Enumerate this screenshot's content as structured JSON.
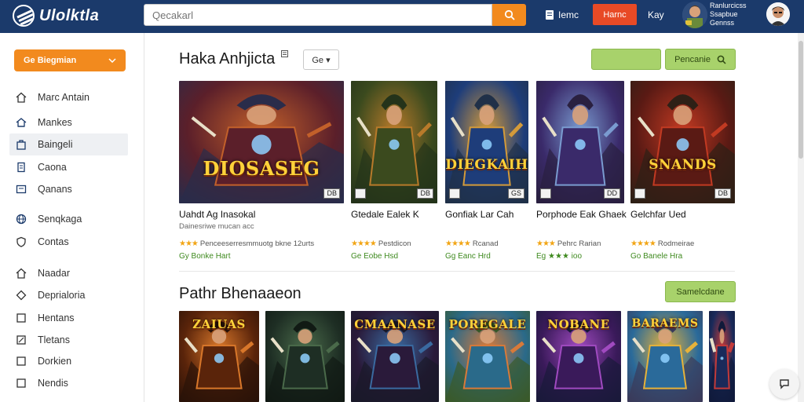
{
  "header": {
    "logo_text": "Ulolktla",
    "search_placeholder": "Qecakarl",
    "link1": "Iemc",
    "button": "Harnc",
    "link2": "Kay",
    "user_line1": "Ranlurcicss",
    "user_line2": "Ssapbue",
    "user_line3": "Gennss"
  },
  "sidebar": {
    "category_button": "Ge Biegmian",
    "items": [
      {
        "label": "Marc Antain",
        "icon": "home-icon"
      },
      {
        "label": "Mankes",
        "icon": "house-icon"
      },
      {
        "label": "Baingeli",
        "icon": "bag-icon"
      },
      {
        "label": "Caona",
        "icon": "document-icon"
      },
      {
        "label": "Qanans",
        "icon": "tablet-icon"
      },
      {
        "label": "Senqkaga",
        "icon": "globe-icon"
      },
      {
        "label": "Contas",
        "icon": "shield-icon"
      },
      {
        "label": "Naadar",
        "icon": "home-outline-icon"
      },
      {
        "label": "Deprialoria",
        "icon": "diamond-icon"
      },
      {
        "label": "Hentans",
        "icon": "square-icon"
      },
      {
        "label": "Tletans",
        "icon": "edit-icon"
      },
      {
        "label": "Dorkien",
        "icon": "square-icon"
      },
      {
        "label": "Nendis",
        "icon": "square-icon"
      }
    ]
  },
  "section1": {
    "title": "Haka Anhjicta",
    "sort_label": "Ge ▾",
    "button_plain": "",
    "button_search": "Pencanie",
    "games": [
      {
        "thumb_text": "DIOSASEG",
        "tag": "DB",
        "title": "Uahdt Ag Inasokal",
        "sub": "Dainesriwe mucan acc",
        "stars": "★★★",
        "rating": "Penceeserresmmuotg bkne 12urts",
        "price": "Gy Bonke Hart",
        "colors": [
          "#5b1f2a",
          "#c2602a",
          "#2a2c4a"
        ]
      },
      {
        "thumb_text": "",
        "tag": "DB",
        "title": "Gtedale Ealek K",
        "sub": "",
        "stars": "★★★★",
        "rating": "Pestdicon",
        "price": "Ge Eobe Hsd",
        "colors": [
          "#3b4a1e",
          "#b87a2a",
          "#24331a"
        ]
      },
      {
        "thumb_text": "DIEGKAIH",
        "tag": "GS",
        "title": "Gonfiak Lar Cah",
        "sub": "",
        "stars": "★★★★",
        "rating": "Rcanad",
        "price": "Gg Eanc Hrd",
        "colors": [
          "#1e3d7a",
          "#d39a3a",
          "#203048"
        ]
      },
      {
        "thumb_text": "",
        "tag": "DD",
        "title": "Porphode Eak Ghaek",
        "sub": "",
        "stars": "★★★",
        "rating": "Pehrc Rarian",
        "price": "Eg ★★★ ioo",
        "colors": [
          "#3a2a6a",
          "#7a9bd0",
          "#2a2040"
        ]
      },
      {
        "thumb_text": "SNANDS",
        "tag": "DB",
        "title": "Gelchfar Ued",
        "sub": "",
        "stars": "★★★★",
        "rating": "Rodmeirae",
        "price": "Go Banele Hra",
        "colors": [
          "#5a1a14",
          "#c23a22",
          "#2e2016"
        ]
      }
    ]
  },
  "section2": {
    "title": "Pathr Bhenaaeon",
    "button": "Samelcdane",
    "games": [
      {
        "thumb_text": "ZAIUAS",
        "colors": [
          "#5a240a",
          "#d8772a",
          "#2a1208"
        ]
      },
      {
        "thumb_text": "",
        "colors": [
          "#1e2e24",
          "#4a6a4a",
          "#111a14"
        ]
      },
      {
        "thumb_text": "CMAANASE",
        "colors": [
          "#2a1a3a",
          "#3a6aa0",
          "#1a1a2a"
        ]
      },
      {
        "thumb_text": "POREGALE",
        "colors": [
          "#2a6a8a",
          "#d77a3a",
          "#3a5a2a"
        ]
      },
      {
        "thumb_text": "NOBANE",
        "colors": [
          "#3a1a5a",
          "#a04ac0",
          "#1a1a3a"
        ]
      },
      {
        "thumb_text": "BARAEMS",
        "colors": [
          "#2a6a9a",
          "#e6b23a",
          "#3a3a5a"
        ]
      },
      {
        "thumb_text": "",
        "colors": [
          "#1a2a5a",
          "#c23a3a",
          "#101a3a"
        ]
      }
    ]
  }
}
